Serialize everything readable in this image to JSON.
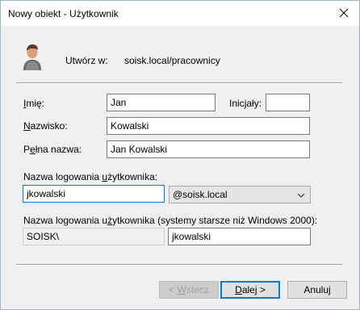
{
  "window": {
    "title": "Nowy obiekt - Użytkownik",
    "close_glyph": "×"
  },
  "header": {
    "avatar_icon": "user-icon",
    "create_in_label": "Utwórz w:",
    "create_in_path": "soisk.local/pracownicy"
  },
  "form": {
    "first_name": {
      "label_pre": "",
      "label_u": "I",
      "label_post": "mię:",
      "value": "Jan"
    },
    "initials": {
      "label_pre": "Inic",
      "label_u": "j",
      "label_post": "ały:",
      "value": ""
    },
    "last_name": {
      "label_pre": "",
      "label_u": "N",
      "label_post": "azwisko:",
      "value": "Kowalski"
    },
    "full_name": {
      "label_pre": "P",
      "label_u": "e",
      "label_post": "łna nazwa:",
      "value": "Jan Kowalski"
    },
    "logon": {
      "label_pre": "Nazwa logowania ",
      "label_u": "u",
      "label_post": "żytkownika:",
      "value": "jkowalski",
      "domain_selected": "@soisk.local"
    },
    "logon_legacy": {
      "label_pre": "Nazwa logowania u",
      "label_u": "ż",
      "label_post": "ytkownika (systemy starsze niż Windows 2000):",
      "domain": "SOISK\\",
      "value": "jkowalski"
    }
  },
  "buttons": {
    "back": {
      "pre": "< ",
      "u": "W",
      "post": "stecz"
    },
    "next": {
      "pre": "",
      "u": "D",
      "post": "alej >"
    },
    "cancel": {
      "pre": "Anuluj",
      "u": "",
      "post": ""
    }
  },
  "colors": {
    "accent": "#0078d7",
    "border": "#7a7a7a"
  }
}
